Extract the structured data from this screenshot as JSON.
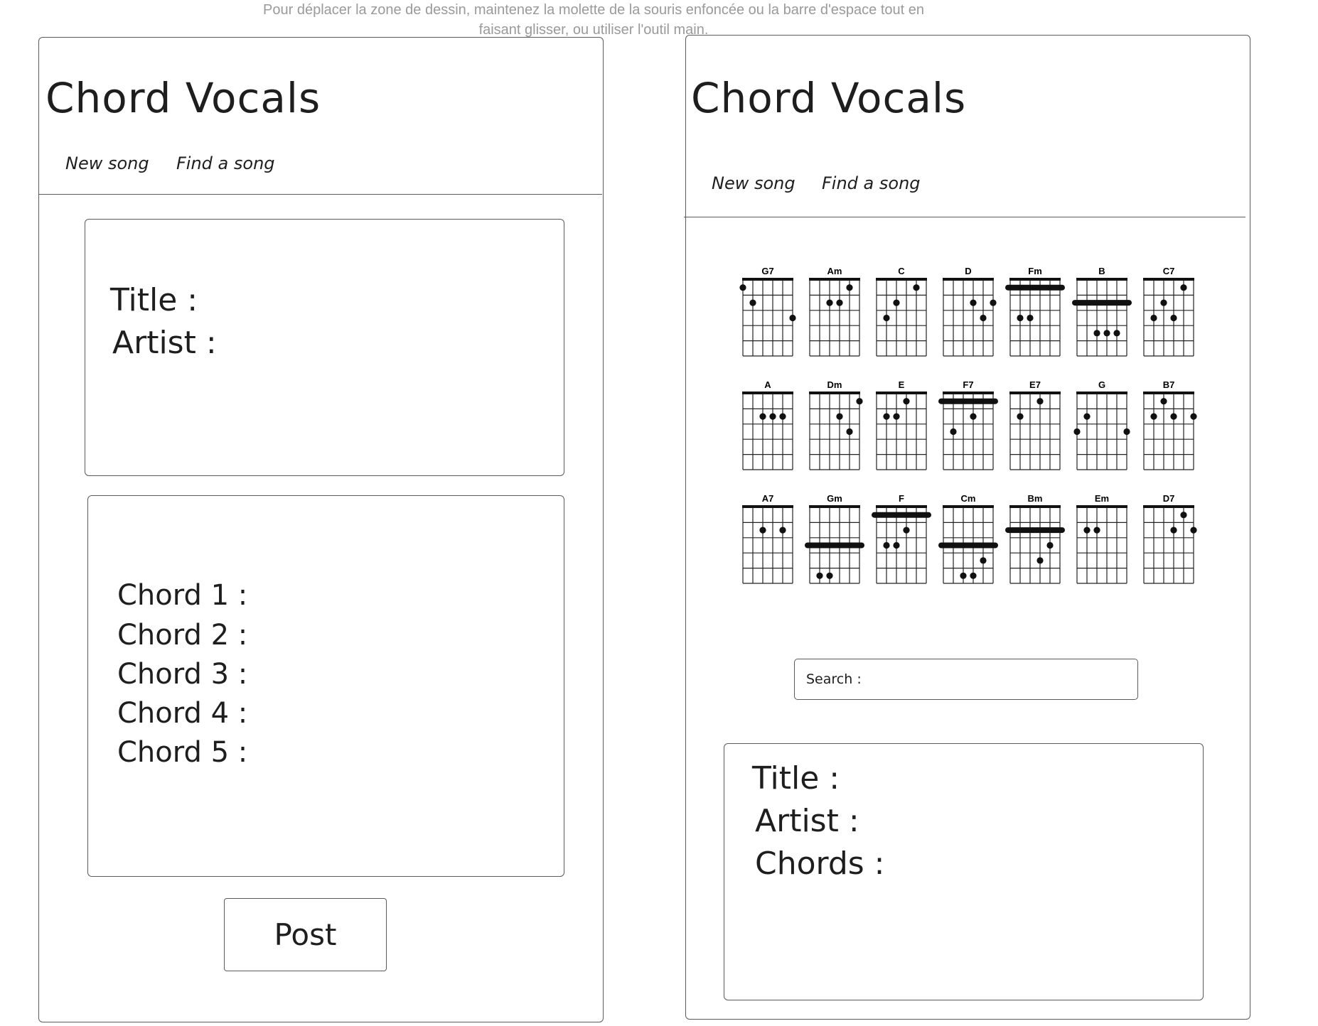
{
  "hint": "Pour déplacer la zone de dessin, maintenez la molette de la souris enfoncée ou la barre d'espace tout en faisant glisser, ou utiliser l'outil main.",
  "left_screen": {
    "app_title": "Chord Vocals",
    "nav": {
      "new_song": "New song",
      "find_song": "Find a song"
    },
    "song_info": {
      "title_label": "Title :",
      "artist_label": "Artist :"
    },
    "chords": [
      "Chord 1 :",
      "Chord 2 :",
      "Chord 3 :",
      "Chord 4 :",
      "Chord 5 :"
    ],
    "post_label": "Post"
  },
  "right_screen": {
    "app_title": "Chord Vocals",
    "nav": {
      "new_song": "New song",
      "find_song": "Find a song"
    },
    "search_label": "Search :",
    "search_value": "",
    "result": {
      "title_label": "Title :",
      "artist_label": "Artist :",
      "chords_label": "Chords :"
    },
    "chord_diagrams": [
      {
        "name": "G7",
        "dots": [
          [
            1,
            6
          ],
          [
            2,
            5
          ],
          [
            3,
            1
          ]
        ]
      },
      {
        "name": "Am",
        "dots": [
          [
            1,
            2
          ],
          [
            2,
            4
          ],
          [
            2,
            3
          ]
        ]
      },
      {
        "name": "C",
        "dots": [
          [
            1,
            2
          ],
          [
            2,
            4
          ],
          [
            3,
            5
          ]
        ]
      },
      {
        "name": "D",
        "dots": [
          [
            2,
            3
          ],
          [
            2,
            1
          ],
          [
            3,
            2
          ]
        ]
      },
      {
        "name": "Fm",
        "barre": 1,
        "dots": [
          [
            3,
            5
          ],
          [
            3,
            4
          ]
        ]
      },
      {
        "name": "B",
        "barre": 2,
        "dots": [
          [
            4,
            4
          ],
          [
            4,
            3
          ],
          [
            4,
            2
          ]
        ]
      },
      {
        "name": "C7",
        "dots": [
          [
            1,
            2
          ],
          [
            2,
            4
          ],
          [
            3,
            5
          ],
          [
            3,
            3
          ]
        ]
      },
      {
        "name": "A",
        "dots": [
          [
            2,
            4
          ],
          [
            2,
            3
          ],
          [
            2,
            2
          ]
        ]
      },
      {
        "name": "Dm",
        "dots": [
          [
            1,
            1
          ],
          [
            2,
            3
          ],
          [
            3,
            2
          ]
        ]
      },
      {
        "name": "E",
        "dots": [
          [
            1,
            3
          ],
          [
            2,
            5
          ],
          [
            2,
            4
          ]
        ]
      },
      {
        "name": "F7",
        "barre": 1,
        "dots": [
          [
            2,
            3
          ],
          [
            3,
            5
          ]
        ]
      },
      {
        "name": "E7",
        "dots": [
          [
            1,
            3
          ],
          [
            2,
            5
          ]
        ]
      },
      {
        "name": "G",
        "dots": [
          [
            2,
            5
          ],
          [
            3,
            6
          ],
          [
            3,
            1
          ]
        ]
      },
      {
        "name": "B7",
        "dots": [
          [
            1,
            4
          ],
          [
            2,
            5
          ],
          [
            2,
            3
          ],
          [
            2,
            1
          ]
        ]
      },
      {
        "name": "A7",
        "dots": [
          [
            2,
            4
          ],
          [
            2,
            2
          ]
        ]
      },
      {
        "name": "Gm",
        "barre": 3,
        "dots": [
          [
            5,
            5
          ],
          [
            5,
            4
          ]
        ]
      },
      {
        "name": "F",
        "barre": 1,
        "dots": [
          [
            2,
            3
          ],
          [
            3,
            5
          ],
          [
            3,
            4
          ]
        ]
      },
      {
        "name": "Cm",
        "barre": 3,
        "dots": [
          [
            4,
            2
          ],
          [
            5,
            4
          ],
          [
            5,
            3
          ]
        ]
      },
      {
        "name": "Bm",
        "barre": 2,
        "dots": [
          [
            3,
            2
          ],
          [
            4,
            3
          ]
        ]
      },
      {
        "name": "Em",
        "dots": [
          [
            2,
            5
          ],
          [
            2,
            4
          ]
        ]
      },
      {
        "name": "D7",
        "dots": [
          [
            1,
            2
          ],
          [
            2,
            3
          ],
          [
            2,
            1
          ]
        ]
      }
    ]
  }
}
